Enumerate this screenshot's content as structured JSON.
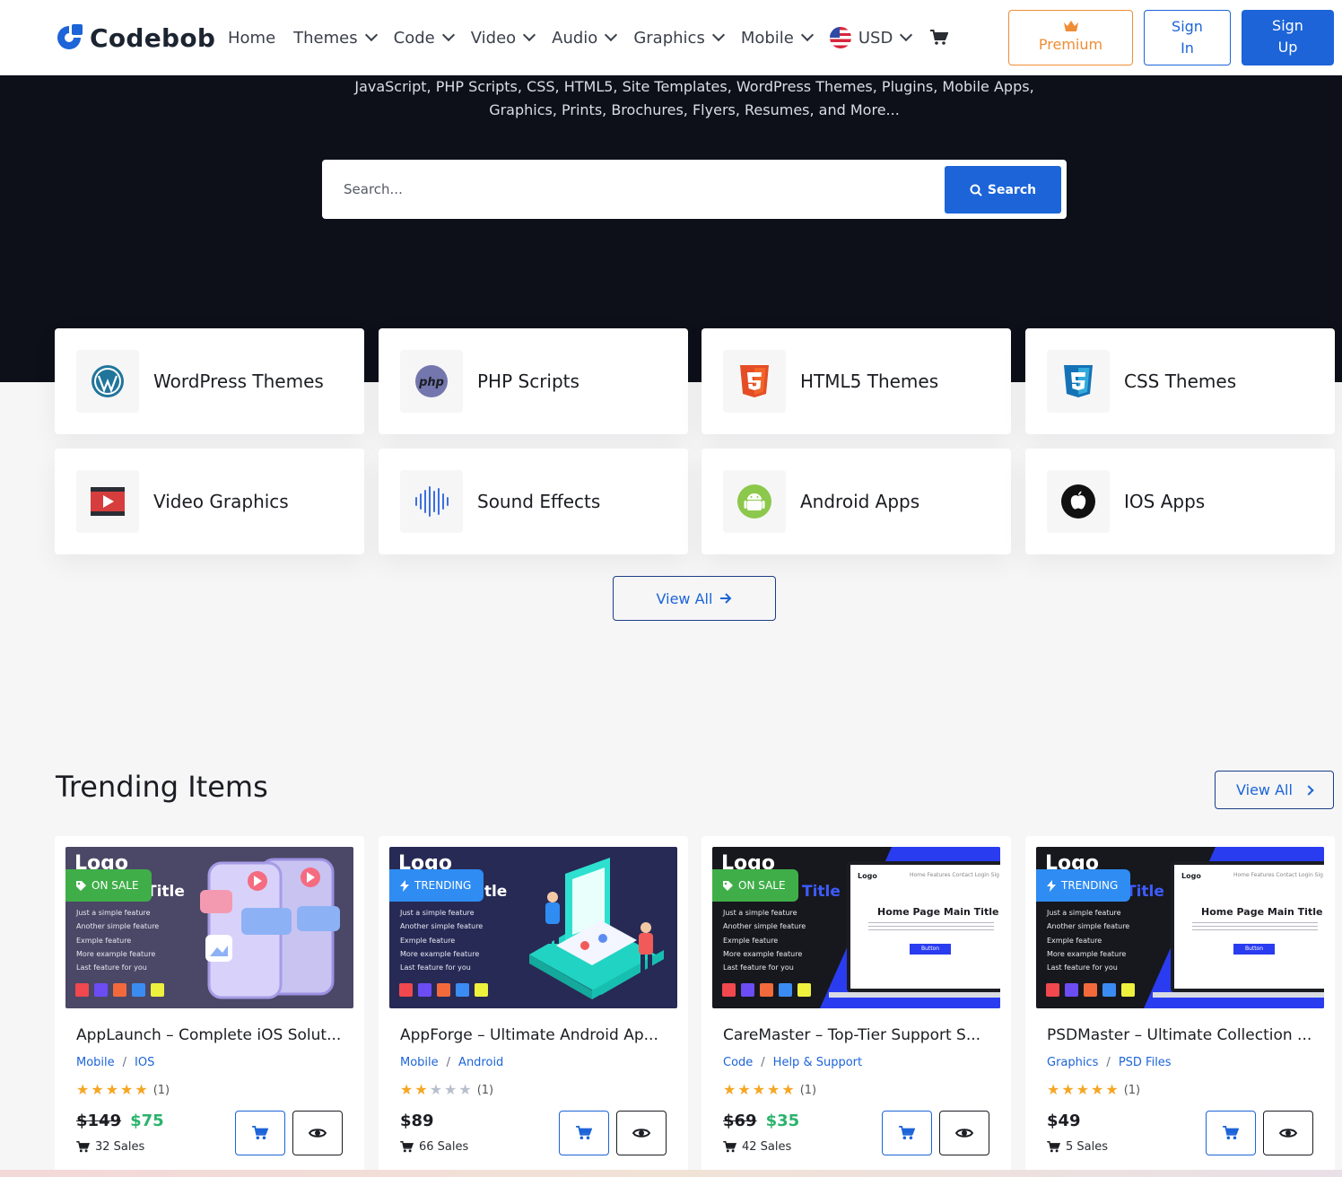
{
  "brand": {
    "name": "Codebob",
    "color": "#1c64d8"
  },
  "nav": {
    "items": [
      {
        "label": "Home",
        "has_dropdown": false
      },
      {
        "label": "Themes",
        "has_dropdown": true
      },
      {
        "label": "Code",
        "has_dropdown": true
      },
      {
        "label": "Video",
        "has_dropdown": true
      },
      {
        "label": "Audio",
        "has_dropdown": true
      },
      {
        "label": "Graphics",
        "has_dropdown": true
      },
      {
        "label": "Mobile",
        "has_dropdown": true
      }
    ],
    "currency": "USD",
    "premium_label": "Premium",
    "signin_label": "Sign In",
    "signup_label": "Sign Up"
  },
  "hero": {
    "subtitle_line1": "JavaScript, PHP Scripts, CSS, HTML5, Site Templates, WordPress Themes, Plugins, Mobile Apps,",
    "subtitle_line2": "Graphics, Prints, Brochures, Flyers, Resumes, and More...",
    "search_placeholder": "Search...",
    "search_button": "Search"
  },
  "categories": [
    {
      "label": "WordPress Themes",
      "icon": "wordpress-icon"
    },
    {
      "label": "PHP Scripts",
      "icon": "php-icon"
    },
    {
      "label": "HTML5 Themes",
      "icon": "html5-icon"
    },
    {
      "label": "CSS Themes",
      "icon": "css3-icon"
    },
    {
      "label": "Video Graphics",
      "icon": "video-icon"
    },
    {
      "label": "Sound Effects",
      "icon": "sound-wave-icon"
    },
    {
      "label": "Android Apps",
      "icon": "android-icon"
    },
    {
      "label": "IOS Apps",
      "icon": "apple-icon"
    }
  ],
  "categories_view_all": "View All",
  "trending": {
    "title": "Trending Items",
    "view_all": "View All",
    "items": [
      {
        "name": "AppLaunch – Complete iOS Solut...",
        "category": "Mobile",
        "subcategory": "IOS",
        "rating": 5,
        "reviews": "(1)",
        "old_price": "$149",
        "price": "$75",
        "sales": "32 Sales",
        "badge": "ON SALE",
        "thumb": {
          "logo": "Logo",
          "title": "Title",
          "features": [
            "Just a simple feature",
            "Another simple feature",
            "Exmple feature",
            "More example feature",
            "Last feature for you"
          ]
        }
      },
      {
        "name": "AppForge – Ultimate Android Ap...",
        "category": "Mobile",
        "subcategory": "Android",
        "rating": 2,
        "reviews": "(1)",
        "old_price": "",
        "price": "$89",
        "sales": "66 Sales",
        "badge": "TRENDING",
        "thumb": {
          "logo": "Logo",
          "title": "itle",
          "features": [
            "Just a simple feature",
            "Another simple feature",
            "Exmple feature",
            "More example feature",
            "Last feature for you"
          ]
        }
      },
      {
        "name": "CareMaster – Top-Tier Support S...",
        "category": "Code",
        "subcategory": "Help & Support",
        "rating": 5,
        "reviews": "(1)",
        "old_price": "$69",
        "price": "$35",
        "sales": "42 Sales",
        "badge": "ON SALE",
        "thumb": {
          "logo": "Logo",
          "title": "Title",
          "features": [
            "Just a simple feature",
            "Another simple feature",
            "Exmple feature",
            "More example feature",
            "Last feature for you"
          ],
          "mock_logo": "Logo",
          "mock_nav": "Home Features Contact Login Sig",
          "mock_title": "Home Page Main Title",
          "mock_button": "Button"
        }
      },
      {
        "name": "PSDMaster – Ultimate Collection ...",
        "category": "Graphics",
        "subcategory": "PSD Files",
        "rating": 5,
        "reviews": "(1)",
        "old_price": "",
        "price": "$49",
        "sales": "5 Sales",
        "badge": "TRENDING",
        "thumb": {
          "logo": "Logo",
          "title": "Title",
          "features": [
            "Just a simple feature",
            "Another simple feature",
            "Exmple feature",
            "More example feature",
            "Last feature for you"
          ],
          "mock_logo": "Logo",
          "mock_nav": "Home Features Contact Login Sig",
          "mock_title": "Home Page Main Title",
          "mock_button": "Button"
        }
      }
    ]
  },
  "colors": {
    "accent": "#1c64d8",
    "premium": "#ef8d36",
    "sale_green": "#2bb36c",
    "badge_sale": "#3fae49",
    "badge_trending": "#2f8cf2",
    "star": "#f5a623",
    "star_empty": "#b8bfcc",
    "hero_bg": "#0d1019"
  }
}
